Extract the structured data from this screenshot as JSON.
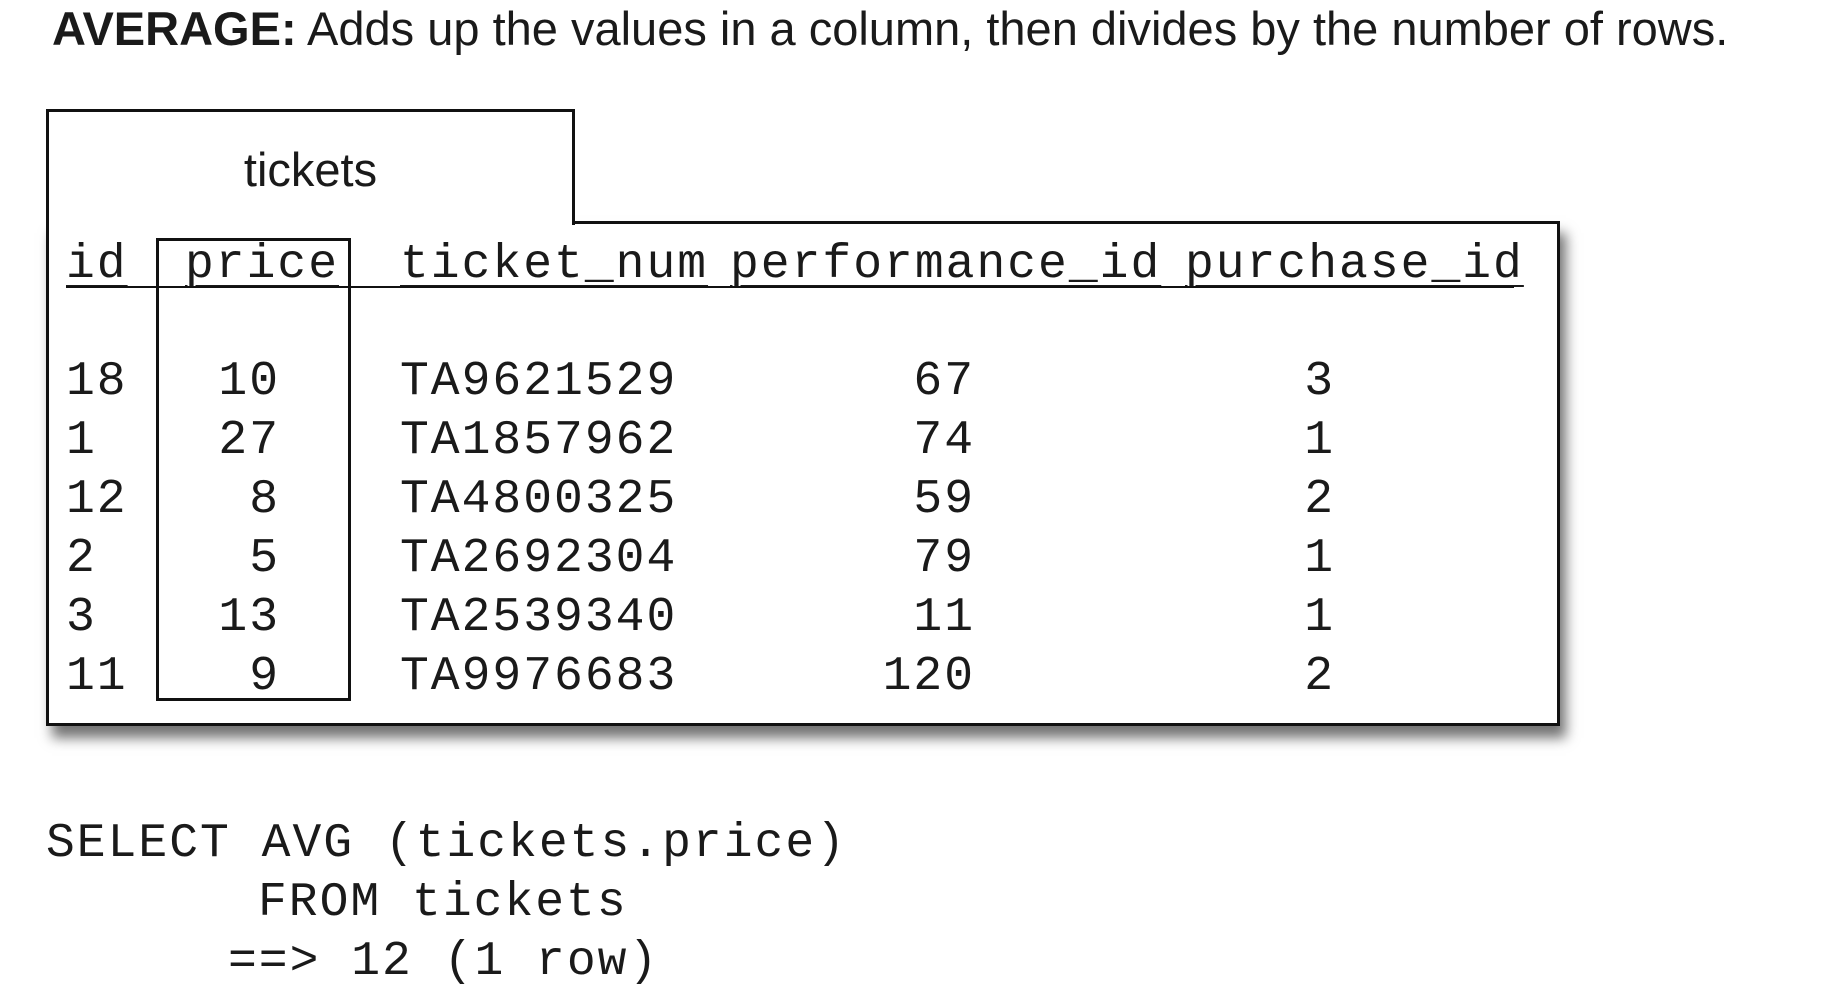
{
  "heading": {
    "bold": "AVERAGE:",
    "text": " Adds up the values in a column, then divides by the number of rows."
  },
  "table": {
    "name": "tickets",
    "columns": [
      "id",
      "price",
      "ticket_num",
      "performance_id",
      "purchase_id"
    ],
    "highlighted_column": "price",
    "rows": [
      {
        "id": "18",
        "price": "10",
        "ticket_num": "TA9621529",
        "performance_id": "67",
        "purchase_id": "3"
      },
      {
        "id": "1",
        "price": "27",
        "ticket_num": "TA1857962",
        "performance_id": "74",
        "purchase_id": "1"
      },
      {
        "id": "12",
        "price": "8",
        "ticket_num": "TA4800325",
        "performance_id": "59",
        "purchase_id": "2"
      },
      {
        "id": "2",
        "price": "5",
        "ticket_num": "TA2692304",
        "performance_id": "79",
        "purchase_id": "1"
      },
      {
        "id": "3",
        "price": "13",
        "ticket_num": "TA2539340",
        "performance_id": "11",
        "purchase_id": "1"
      },
      {
        "id": "11",
        "price": "9",
        "ticket_num": "TA9976683",
        "performance_id": "120",
        "purchase_id": "2"
      }
    ]
  },
  "sql": {
    "line1": "SELECT AVG (tickets.price)",
    "line2": "FROM tickets",
    "line3": "==> 12 (1 row)"
  }
}
